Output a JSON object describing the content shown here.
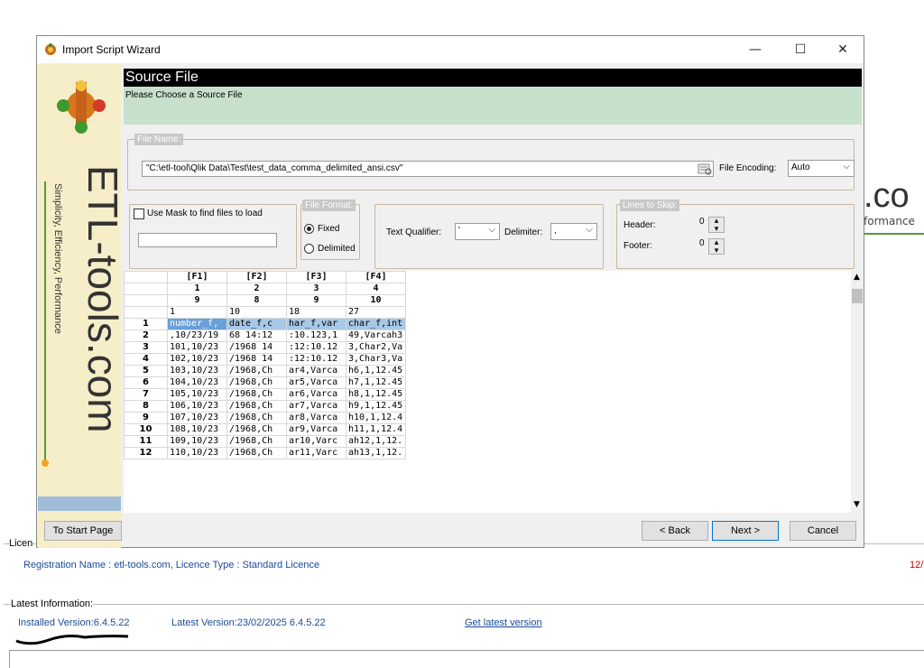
{
  "background": {
    "brand_fragment": ".co",
    "tagline_fragment": "formance",
    "licence": {
      "legend": "Licen",
      "text": "Registration Name : etl-tools.com, Licence Type : Standard Licence",
      "date_fragment": "12/"
    },
    "latest": {
      "legend": "Latest Information:",
      "installed": "Installed Version:6.4.5.22",
      "latest_version": "Latest Version:23/02/2025 6.4.5.22",
      "get_latest": "Get latest version"
    }
  },
  "window": {
    "title": "Import Script Wizard",
    "minimize": "—",
    "maximize": "☐",
    "close": "✕",
    "banner": {
      "brand": "ETL-tools.com",
      "tagline": "Simplicity, Efficiency, Performance"
    },
    "header": {
      "title": "Source File",
      "subtitle": "Please Choose a Source File"
    },
    "file_name": {
      "legend": "File Name:",
      "path": "\"C:\\etl-tool\\Qlik Data\\Test\\test_data_comma_delimited_ansi.csv\"",
      "encoding_label": "File Encoding:",
      "encoding_value": "Auto"
    },
    "mask": {
      "label": "Use Mask to find files to load",
      "value": ""
    },
    "file_format": {
      "legend": "File Format:",
      "fixed": "Fixed",
      "delimited": "Delimited",
      "selected": "Fixed"
    },
    "qualifier": {
      "label": "Text Qualifier:",
      "value": "'"
    },
    "delimiter": {
      "label": "Delimiter:",
      "value": ","
    },
    "lines_to_skip": {
      "legend": "Lines to Skip:",
      "header_label": "Header:",
      "header_value": "0",
      "footer_label": "Footer:",
      "footer_value": "0"
    },
    "grid": {
      "columns": [
        "[F1]",
        "[F2]",
        "[F3]",
        "[F4]"
      ],
      "meta_rows": [
        [
          "1",
          "2",
          "3",
          "4"
        ],
        [
          "9",
          "8",
          "9",
          "10"
        ],
        [
          "1",
          "10",
          "18",
          "27"
        ]
      ],
      "rows": [
        {
          "n": "1",
          "cells": [
            "number_f,",
            "date_f,c",
            "har_f,var",
            "char_f,int"
          ]
        },
        {
          "n": "2",
          "cells": [
            ",10/23/19",
            "68 14:12",
            ":10.123,1",
            "49,Varcah3"
          ]
        },
        {
          "n": "3",
          "cells": [
            "101,10/23",
            "/1968 14",
            ":12:10.12",
            "3,Char2,Va"
          ]
        },
        {
          "n": "4",
          "cells": [
            "102,10/23",
            "/1968 14",
            ":12:10.12",
            "3,Char3,Va"
          ]
        },
        {
          "n": "5",
          "cells": [
            "103,10/23",
            "/1968,Ch",
            "ar4,Varca",
            "h6,1,12.45"
          ]
        },
        {
          "n": "6",
          "cells": [
            "104,10/23",
            "/1968,Ch",
            "ar5,Varca",
            "h7,1,12.45"
          ]
        },
        {
          "n": "7",
          "cells": [
            "105,10/23",
            "/1968,Ch",
            "ar6,Varca",
            "h8,1,12.45"
          ]
        },
        {
          "n": "8",
          "cells": [
            "106,10/23",
            "/1968,Ch",
            "ar7,Varca",
            "h9,1,12.45"
          ]
        },
        {
          "n": "9",
          "cells": [
            "107,10/23",
            "/1968,Ch",
            "ar8,Varca",
            "h10,1,12.4"
          ]
        },
        {
          "n": "10",
          "cells": [
            "108,10/23",
            "/1968,Ch",
            "ar9,Varca",
            "h11,1,12.4"
          ]
        },
        {
          "n": "11",
          "cells": [
            "109,10/23",
            "/1968,Ch",
            "ar10,Varc",
            "ah12,1,12."
          ]
        },
        {
          "n": "12",
          "cells": [
            "110,10/23",
            "/1968,Ch",
            "ar11,Varc",
            "ah13,1,12."
          ]
        }
      ]
    },
    "buttons": {
      "start_page": "To Start Page",
      "back": "< Back",
      "next": "Next >",
      "cancel": "Cancel"
    }
  }
}
